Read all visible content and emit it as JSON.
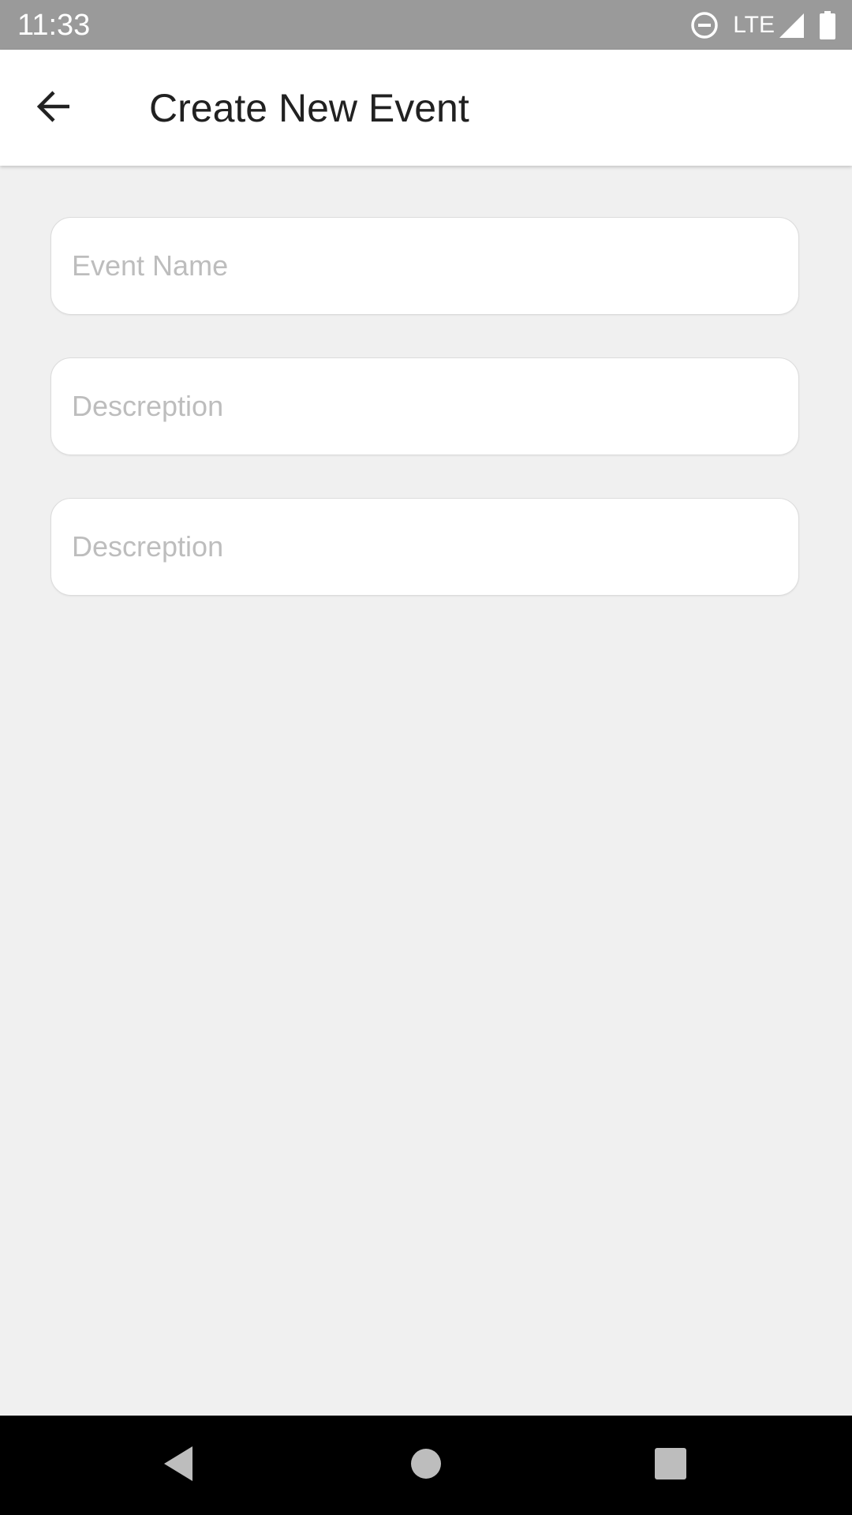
{
  "status_bar": {
    "time": "11:33",
    "network": "LTE",
    "icons": [
      "do-not-disturb-icon",
      "signal-icon",
      "battery-icon"
    ]
  },
  "app_bar": {
    "title": "Create New Event",
    "back_icon": "arrow-back-icon"
  },
  "form": {
    "fields": [
      {
        "placeholder": "Event Name",
        "value": ""
      },
      {
        "placeholder": "Descreption",
        "value": ""
      },
      {
        "placeholder": "Descreption",
        "value": ""
      }
    ]
  },
  "nav_bar": {
    "icons": [
      "nav-back-icon",
      "nav-home-icon",
      "nav-recents-icon"
    ]
  },
  "colors": {
    "status_bar_bg": "#9a9a9a",
    "app_bar_bg": "#ffffff",
    "page_bg": "#f0f0f0",
    "field_bg": "#ffffff",
    "placeholder_text": "#bdbdbd",
    "title_text": "#212121",
    "nav_bar_bg": "#000000"
  }
}
